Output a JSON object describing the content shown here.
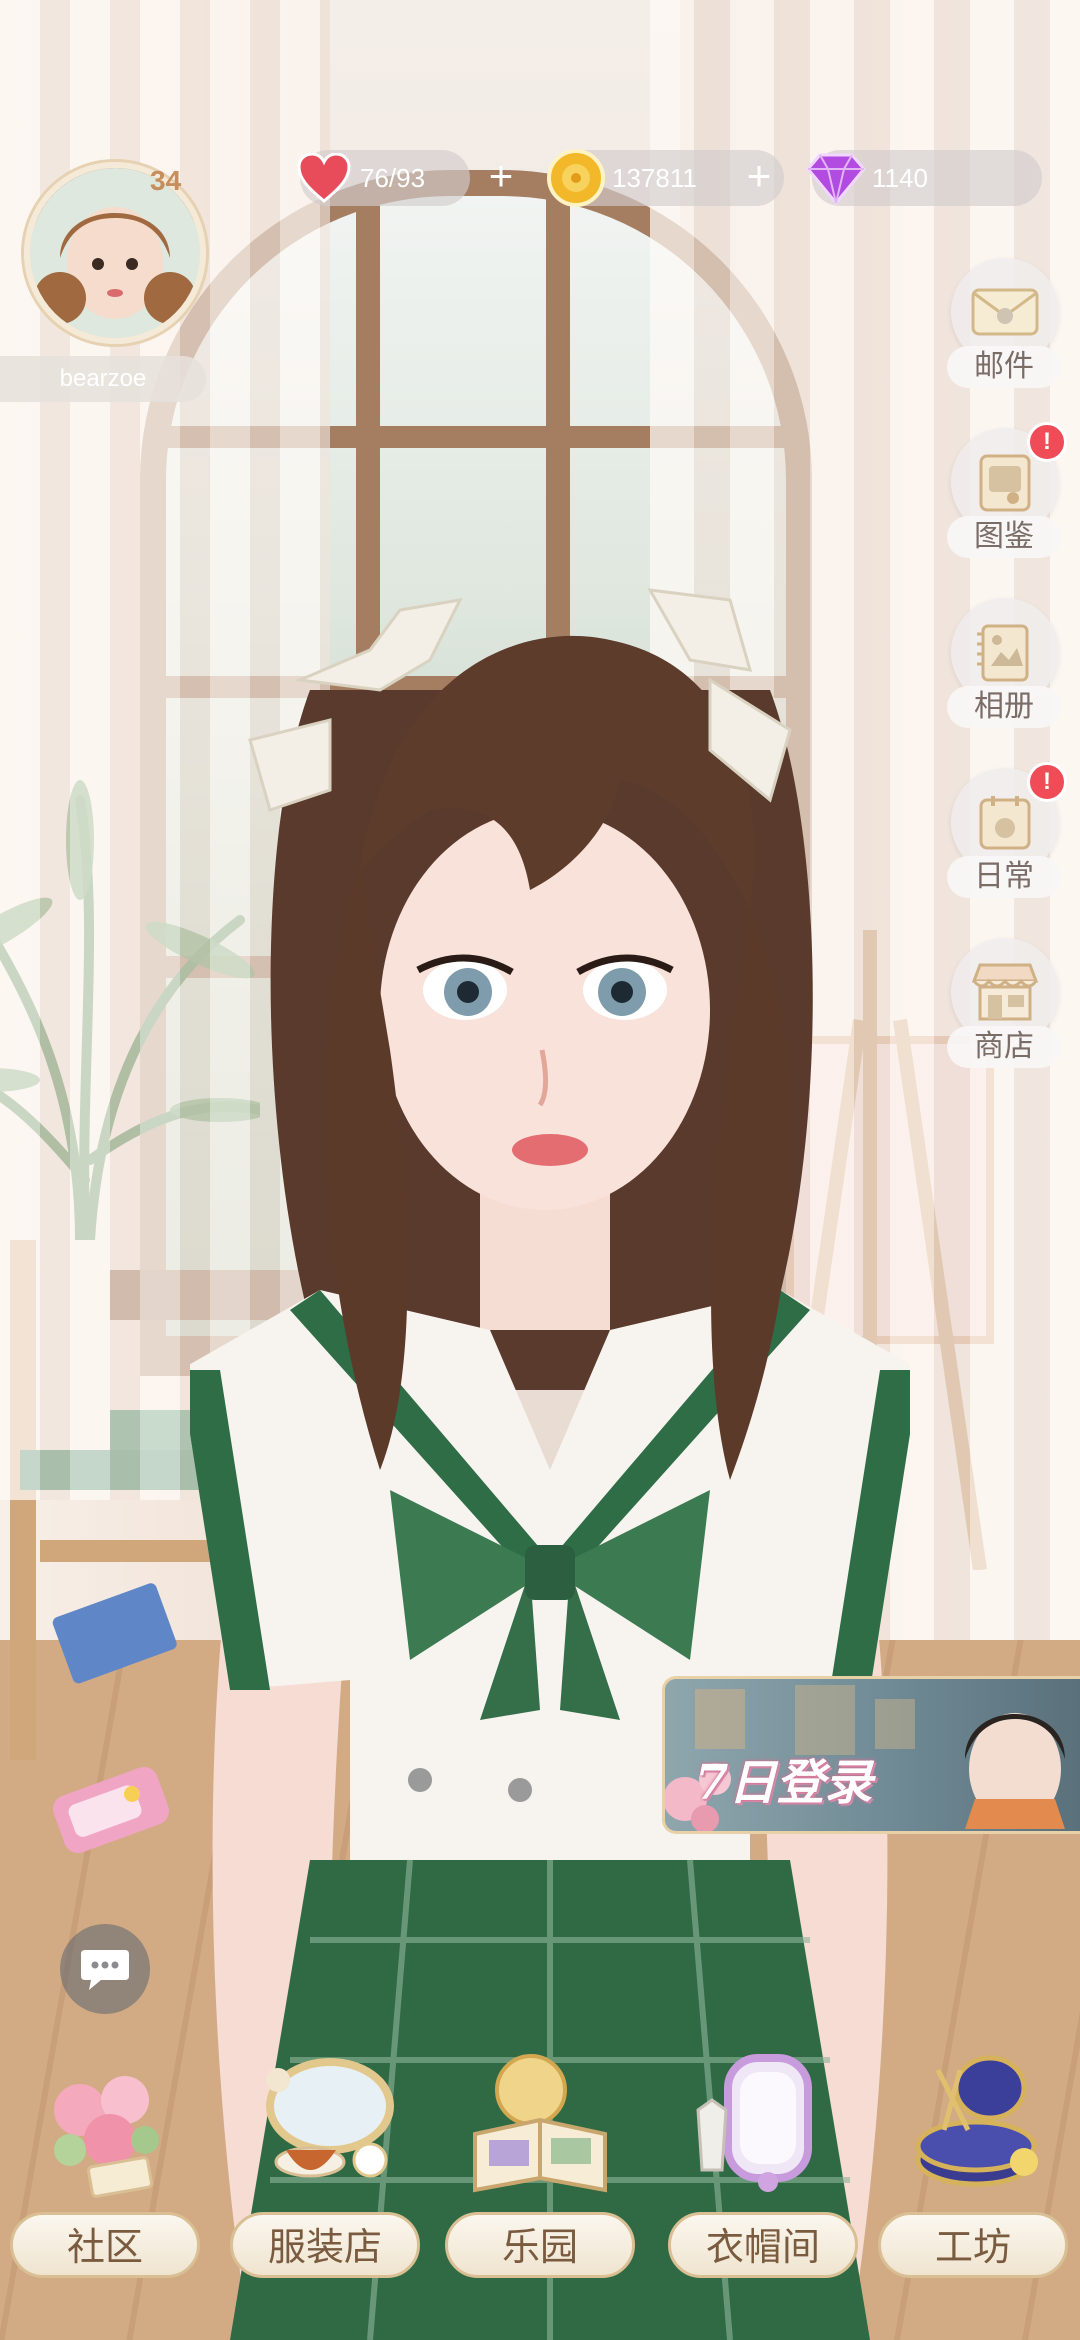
{
  "player": {
    "username": "bearzoe",
    "level": "34"
  },
  "resources": {
    "stamina": {
      "value": "76/93",
      "icon": "heart-icon",
      "color": "#e84b5a"
    },
    "gold": {
      "value": "137811",
      "icon": "coin-icon",
      "color": "#f2b82a"
    },
    "diamond": {
      "value": "1140",
      "icon": "diamond-icon",
      "color": "#b24be0"
    },
    "add_symbol": "+"
  },
  "side_menu": [
    {
      "label": "邮件",
      "icon": "mail-icon",
      "alert": false
    },
    {
      "label": "图鉴",
      "icon": "collection-icon",
      "alert": true
    },
    {
      "label": "相册",
      "icon": "album-icon",
      "alert": false
    },
    {
      "label": "日常",
      "icon": "daily-icon",
      "alert": true
    },
    {
      "label": "商店",
      "icon": "shop-icon",
      "alert": false
    }
  ],
  "alert_symbol": "!",
  "event_banner": {
    "title": "7日登录"
  },
  "bottom_nav": [
    {
      "label": "社区",
      "icon": "flower-bouquet-icon"
    },
    {
      "label": "服装店",
      "icon": "tea-mirror-icon"
    },
    {
      "label": "乐园",
      "icon": "storybook-icon"
    },
    {
      "label": "衣帽间",
      "icon": "wardrobe-mirror-icon"
    },
    {
      "label": "工坊",
      "icon": "sewing-box-icon"
    }
  ],
  "colors": {
    "accent": "#d9bf93",
    "label_text": "#7a5b3f",
    "alert": "#ef4c57"
  }
}
